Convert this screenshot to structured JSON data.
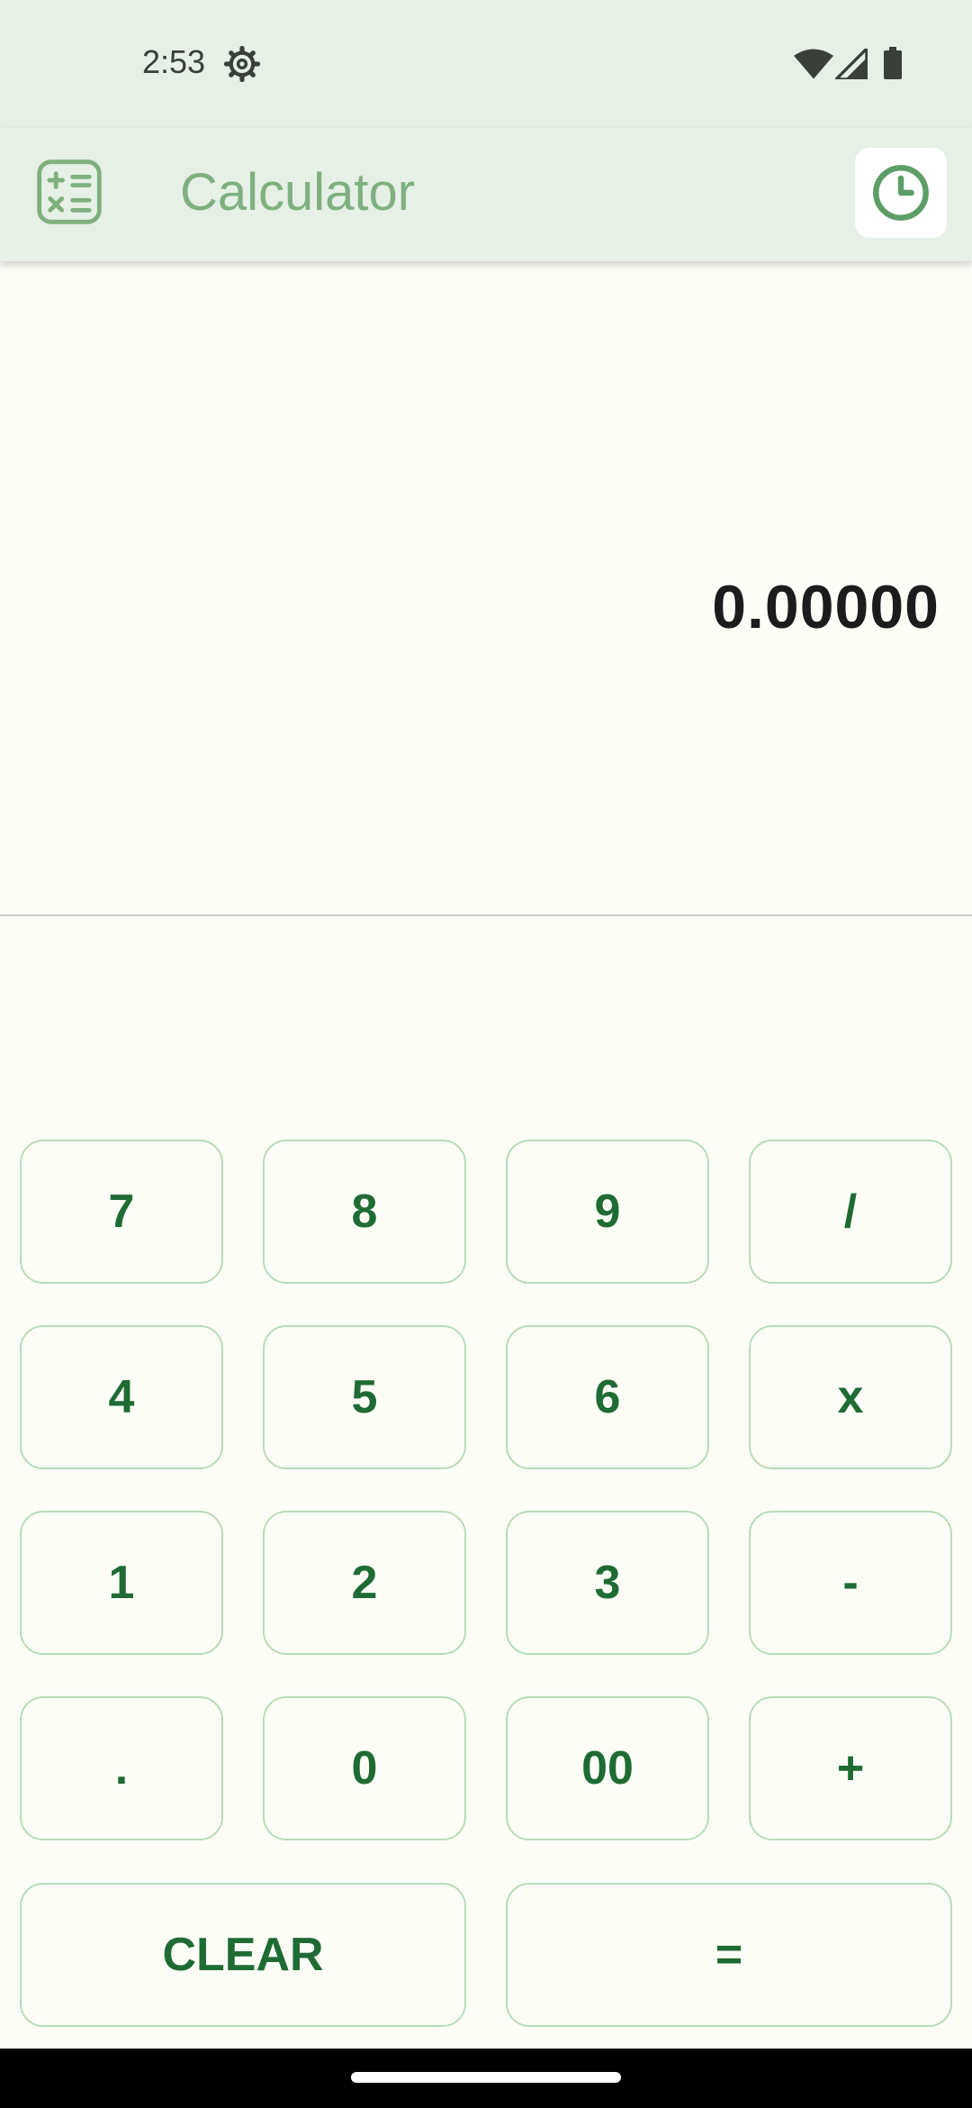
{
  "status_bar": {
    "time": "2:53",
    "icons": [
      "gear-icon",
      "wifi-icon",
      "cellular-signal-icon",
      "battery-icon"
    ]
  },
  "app_bar": {
    "title": "Calculator",
    "app_icon": "calculator-icon",
    "history_icon": "clock-icon"
  },
  "display": {
    "value": "0.00000"
  },
  "keypad": {
    "rows": [
      [
        "7",
        "8",
        "9",
        "/"
      ],
      [
        "4",
        "5",
        "6",
        "x"
      ],
      [
        "1",
        "2",
        "3",
        "-"
      ],
      [
        ".",
        "0",
        "00",
        "+"
      ],
      [
        "CLEAR",
        "="
      ]
    ]
  },
  "colors": {
    "app_bar_bg": "#e6f0e6",
    "title": "#7fb07f",
    "key_text": "#1f6b34",
    "key_border": "#b8dcb8",
    "background": "#fcfdf7"
  }
}
